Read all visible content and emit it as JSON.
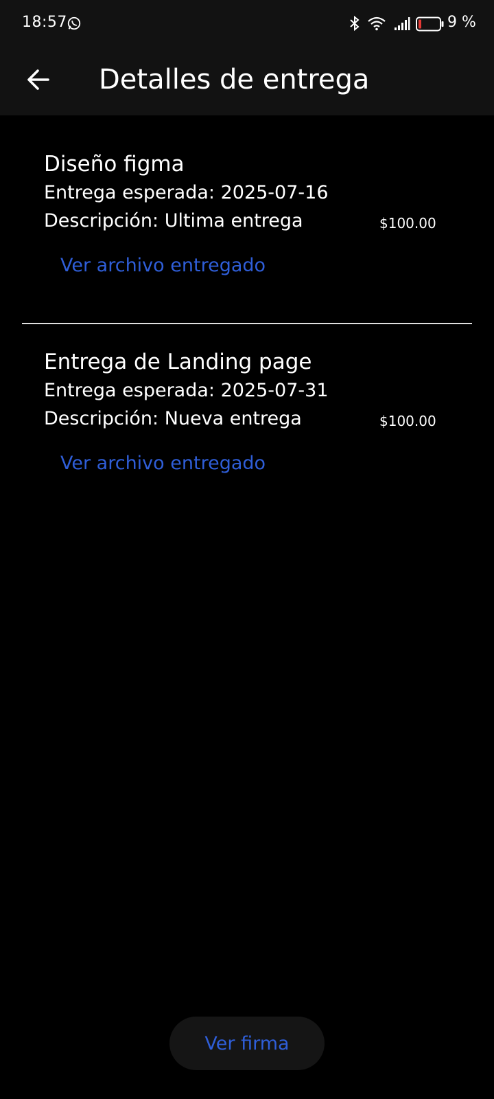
{
  "status_bar": {
    "time": "18:57",
    "battery_text": "9 %",
    "icons": [
      "whatsapp-icon",
      "bluetooth-icon",
      "wifi-icon",
      "signal-icon",
      "battery-icon"
    ]
  },
  "app_bar": {
    "title": "Detalles de entrega",
    "back_icon": "arrow-left-icon"
  },
  "deliveries": [
    {
      "title": "Diseño figma",
      "expected": "Entrega esperada: 2025-07-16",
      "description": "Descripción: Ultima entrega",
      "price": "$100.00",
      "link": "Ver archivo entregado"
    },
    {
      "title": "Entrega de Landing page",
      "expected": "Entrega esperada: 2025-07-31",
      "description": "Descripción: Nueva entrega",
      "price": "$100.00",
      "link": "Ver archivo entregado"
    }
  ],
  "footer": {
    "signature_button": "Ver firma"
  },
  "colors": {
    "background": "#000000",
    "bar": "#121212",
    "link": "#2f5ed8",
    "battery_low": "#e53935"
  }
}
